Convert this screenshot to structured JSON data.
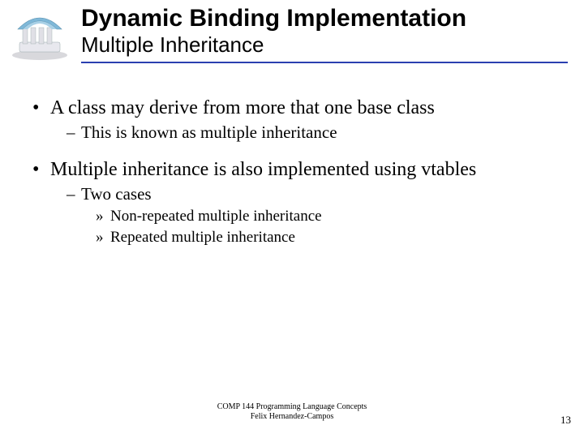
{
  "header": {
    "title": "Dynamic Binding Implementation",
    "subtitle": "Multiple Inheritance"
  },
  "bullets": {
    "b1a": "A class may derive from more that one base class",
    "b2a": "This is known as multiple inheritance",
    "b1b": "Multiple inheritance is also implemented using vtables",
    "b2b": "Two cases",
    "b3a": "Non-repeated multiple inheritance",
    "b3b": "Repeated multiple inheritance"
  },
  "footer": {
    "line1": "COMP 144 Programming Language Concepts",
    "line2": "Felix Hernandez-Campos"
  },
  "page_number": "13"
}
